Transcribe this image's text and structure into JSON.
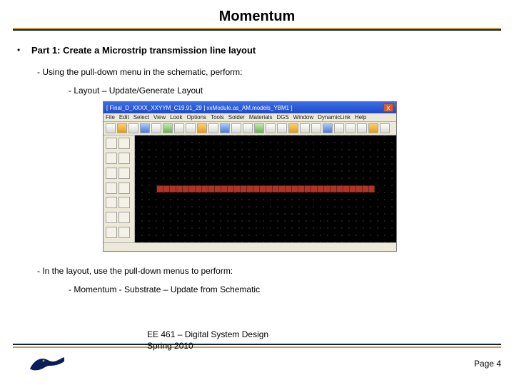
{
  "title": "Momentum",
  "heading": "Part 1: Create a Microstrip transmission line layout",
  "body": {
    "line1": "- Using the pull-down menu in the schematic, perform:",
    "line2": "- Layout – Update/Generate Layout",
    "line3": "- In the layout, use the pull-down menus to perform:",
    "line4": "- Momentum - Substrate – Update from Schematic"
  },
  "screenshot": {
    "titlebar": "[ Final_D_XXXX_XXYYM_C19.91_29 ] xxModule.as_AM.models_YBM1 ]",
    "menus": [
      "File",
      "Edit",
      "Select",
      "View",
      "Look",
      "Options",
      "Tools",
      "Solder",
      "Materials",
      "DGS",
      "Window",
      "DynamicLink",
      "Help"
    ],
    "close": "X"
  },
  "footer": {
    "course_line1": "EE 461 – Digital System Design",
    "course_line2": "Spring 2010",
    "page": "Page 4"
  }
}
